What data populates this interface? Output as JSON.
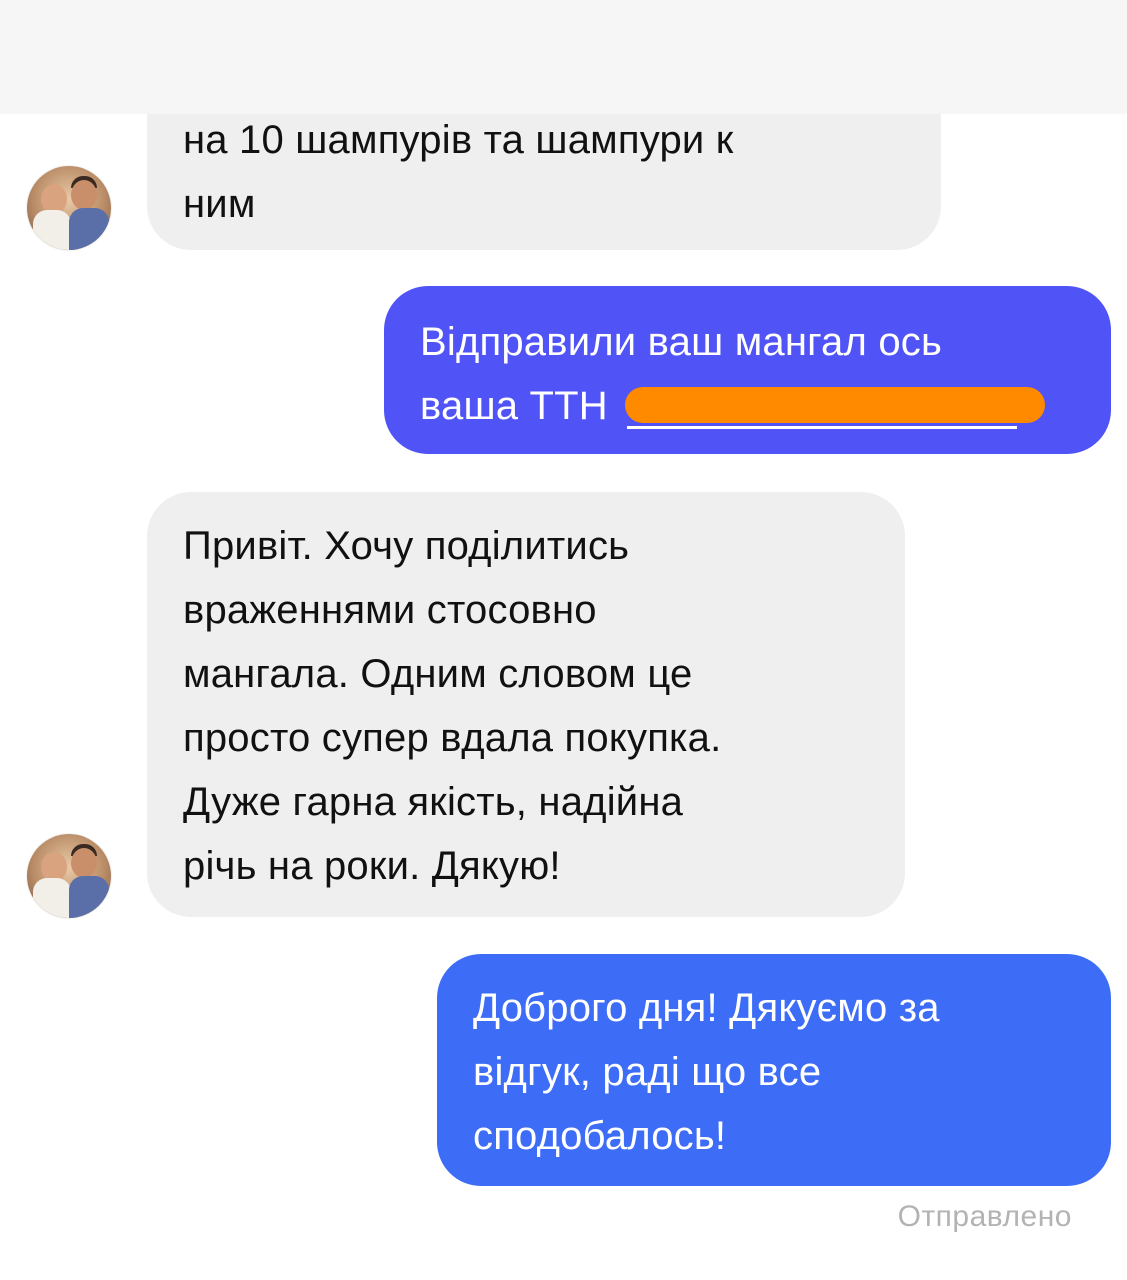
{
  "messages": [
    {
      "direction": "incoming",
      "lines": [
        "на 10 шампурів та шампури к",
        "ним"
      ]
    },
    {
      "direction": "outgoing",
      "lines": [
        "Відправили ваш мангал ось",
        "ваша ТТН"
      ],
      "ttn_redacted": true
    },
    {
      "direction": "incoming",
      "lines": [
        "Привіт. Хочу поділитись",
        "враженнями стосовно",
        "мангала. Одним словом це",
        "просто супер вдала покупка.",
        "Дуже гарна якість, надійна",
        "річь на роки. Дякую!"
      ]
    },
    {
      "direction": "outgoing",
      "lines": [
        "Доброго дня! Дякуємо за",
        "відгук, раді що все",
        "сподобалось!"
      ]
    }
  ],
  "status": "Отправлено",
  "colors": {
    "incoming_bubble": "#efefef",
    "outgoing_bubble_1": "#5053f5",
    "outgoing_bubble_2": "#3d6cf6",
    "redaction": "#ff8a00",
    "status_text": "#b3b3b3"
  },
  "icons": {
    "contact_avatar": "avatar-photo"
  }
}
